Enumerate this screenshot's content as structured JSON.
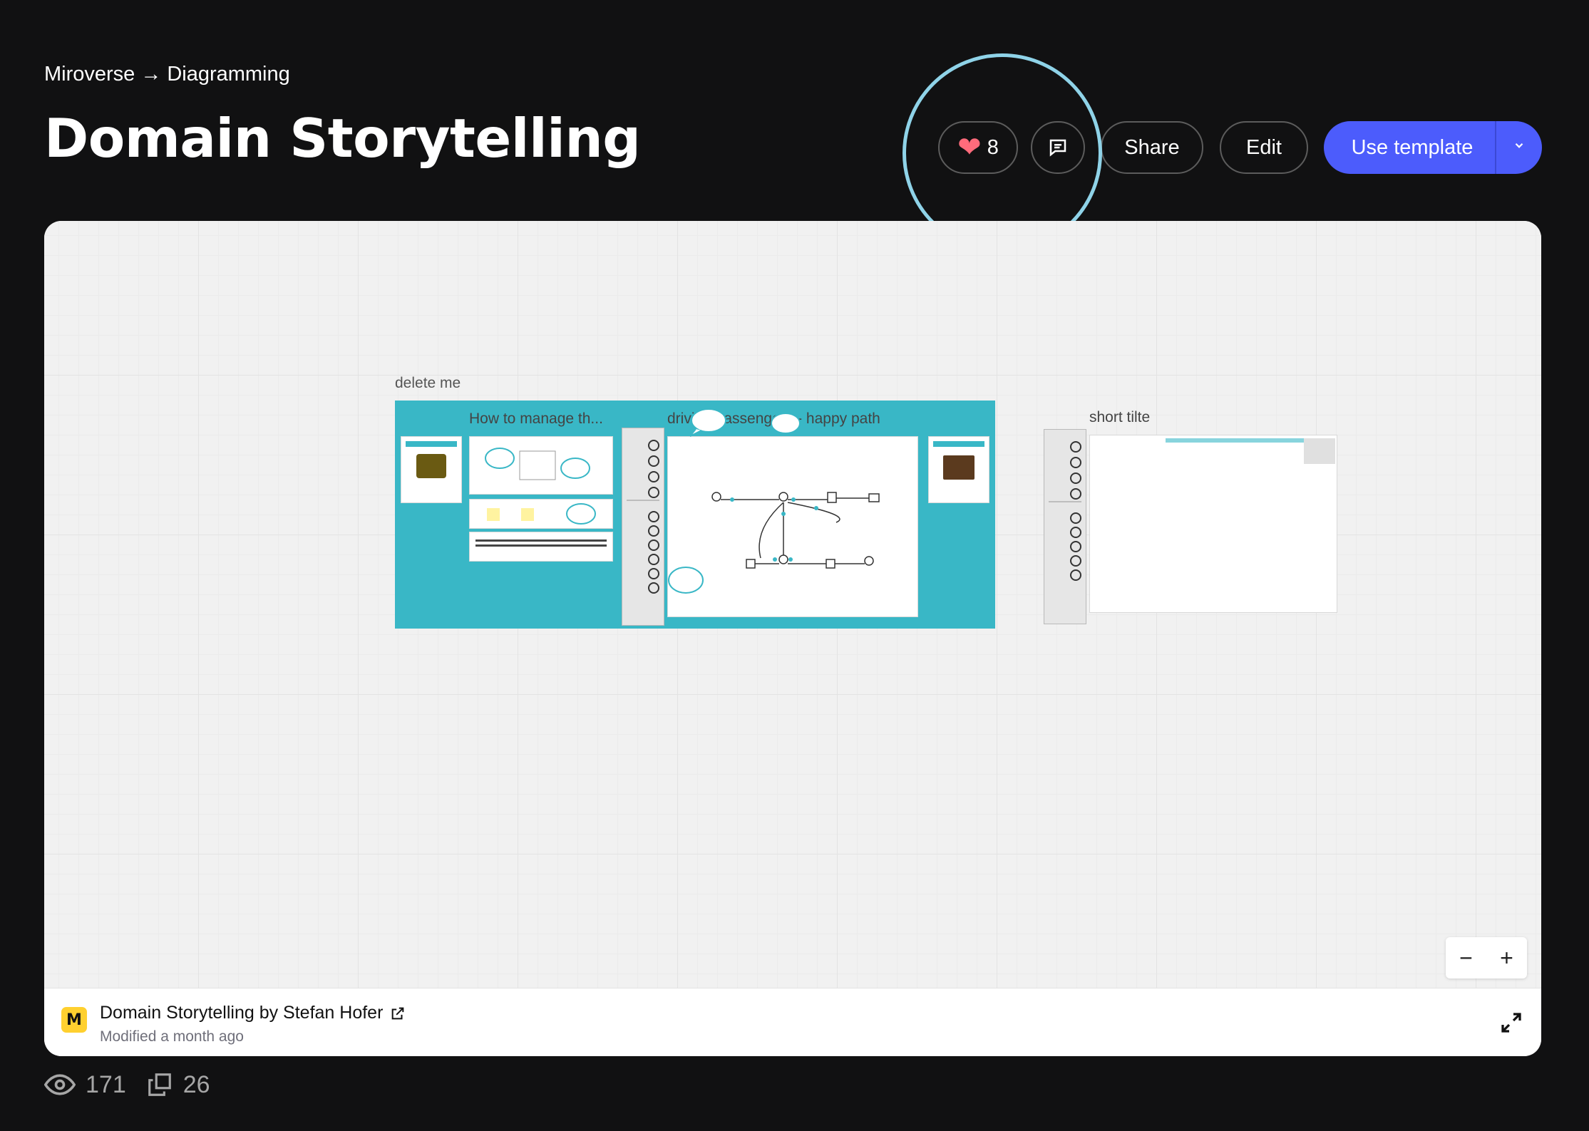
{
  "breadcrumb": {
    "root": "Miroverse",
    "separator": "→",
    "current": "Diagramming"
  },
  "title": "Domain Storytelling",
  "actions": {
    "likes": "8",
    "share_label": "Share",
    "edit_label": "Edit",
    "use_template_label": "Use template",
    "accent": "#4c5cfc",
    "heart_color": "#ff6b7b"
  },
  "board": {
    "labels": {
      "delete_me": "delete me",
      "frame1": "How to manage th...",
      "frame2": "driving passengers - happy path",
      "frame3": "short tilte"
    },
    "footer": {
      "name": "Domain Storytelling by Stefan Hofer",
      "modified": "Modified a month ago"
    }
  },
  "stats": {
    "views": "171",
    "copies": "26"
  }
}
